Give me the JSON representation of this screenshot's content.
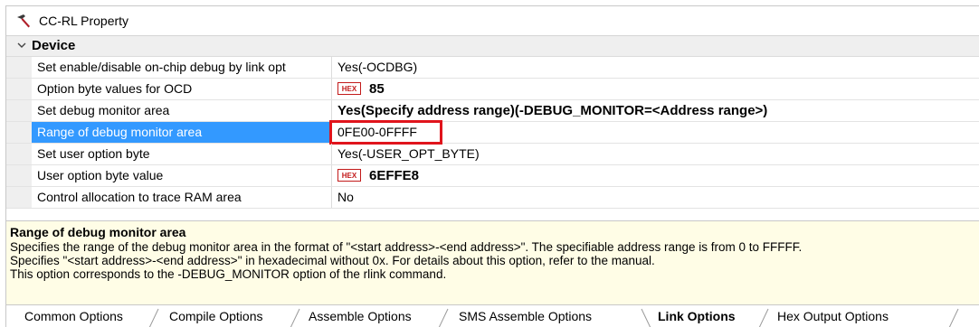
{
  "window": {
    "title": "CC-RL Property",
    "title_icon": "hammer-icon"
  },
  "category": {
    "label": "Device",
    "expanded": true
  },
  "properties": [
    {
      "name": "Set enable/disable on-chip debug by link opt",
      "value": "Yes(-OCDBG)",
      "hex": false,
      "bold": false,
      "selected": false
    },
    {
      "name": "Option byte values for OCD",
      "value": "85",
      "hex": true,
      "bold": true,
      "selected": false
    },
    {
      "name": "Set debug monitor area",
      "value": "Yes(Specify address range)(-DEBUG_MONITOR=<Address range>)",
      "hex": false,
      "bold": true,
      "selected": false
    },
    {
      "name": "Range of debug monitor area",
      "value": "0FE00-0FFFF",
      "hex": false,
      "bold": false,
      "selected": true,
      "highlighted": true
    },
    {
      "name": "Set user option byte",
      "value": "Yes(-USER_OPT_BYTE)",
      "hex": false,
      "bold": false,
      "selected": false
    },
    {
      "name": "User option byte value",
      "value": "6EFFE8",
      "hex": true,
      "bold": true,
      "selected": false
    },
    {
      "name": "Control allocation to trace RAM area",
      "value": "No",
      "hex": false,
      "bold": false,
      "selected": false
    }
  ],
  "hex_badge": "HEX",
  "description": {
    "title": "Range of debug monitor area",
    "lines": [
      "Specifies the range of the debug monitor area in the format of \"<start address>-<end address>\". The specifiable address range is from 0 to FFFFF.",
      "Specifies \"<start address>-<end address>\" in hexadecimal without 0x. For details about this option, refer to the manual.",
      "This option corresponds to the -DEBUG_MONITOR option of the rlink command."
    ]
  },
  "tabs": [
    {
      "label": "Common Options",
      "active": false
    },
    {
      "label": "Compile Options",
      "active": false
    },
    {
      "label": "Assemble Options",
      "active": false
    },
    {
      "label": "SMS Assemble Options",
      "active": false
    },
    {
      "label": "Link Options",
      "active": true
    },
    {
      "label": "Hex Output Options",
      "active": false
    }
  ],
  "colors": {
    "selection": "#3399ff",
    "highlight_box": "#e0141c",
    "description_bg": "#fffde6",
    "hex_badge": "#c21a1a"
  }
}
